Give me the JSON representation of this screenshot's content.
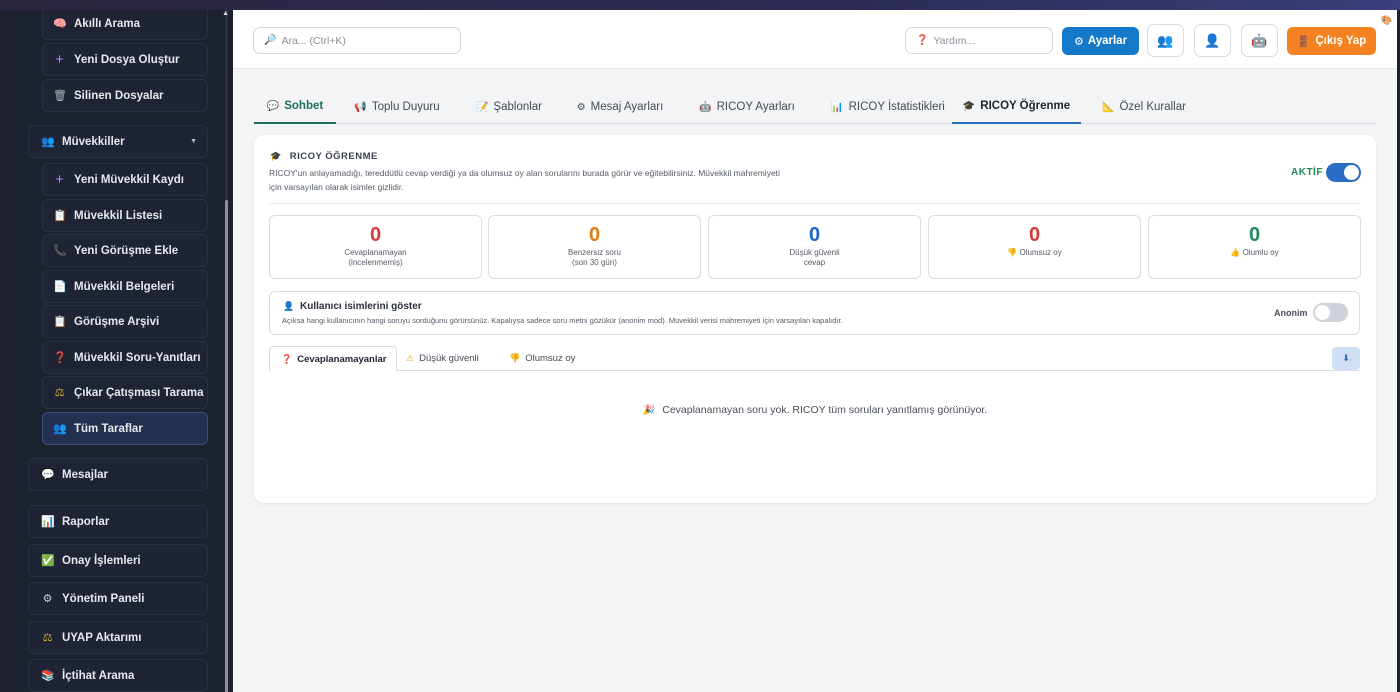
{
  "sidebar": {
    "sub_items_top": [
      {
        "label": "Akıllı Arama",
        "icon": "brain-icon",
        "glyph": "🧠"
      },
      {
        "label": "Yeni Dosya Oluştur",
        "icon": "plus-icon",
        "glyph": "+"
      },
      {
        "label": "Silinen Dosyalar",
        "icon": "trash-icon",
        "glyph": "🗑"
      }
    ],
    "group": {
      "label": "Müvekkiller",
      "icon": "people-icon",
      "glyph": "👥",
      "chevron": "▼"
    },
    "sub_items": [
      {
        "label": "Yeni Müvekkil Kaydı",
        "icon": "plus-icon",
        "glyph": "+"
      },
      {
        "label": "Müvekkil Listesi",
        "icon": "list-icon",
        "glyph": "📋"
      },
      {
        "label": "Yeni Görüşme Ekle",
        "icon": "phone-icon",
        "glyph": "📞"
      },
      {
        "label": "Müvekkil Belgeleri",
        "icon": "document-icon",
        "glyph": "📄"
      },
      {
        "label": "Görüşme Arşivi",
        "icon": "archive-icon",
        "glyph": "📋"
      },
      {
        "label": "Müvekkil Soru-Yanıtları",
        "icon": "question-icon",
        "glyph": "❓"
      },
      {
        "label": "Çıkar Çatışması Tarama",
        "icon": "scale-icon",
        "glyph": "⚖"
      },
      {
        "label": "Tüm Taraflar",
        "icon": "parties-icon",
        "glyph": "👥"
      }
    ],
    "main_items": [
      {
        "label": "Mesajlar",
        "icon": "chat-icon",
        "glyph": "💬"
      },
      {
        "label": "Raporlar",
        "icon": "chart-icon",
        "glyph": "📊"
      },
      {
        "label": "Onay İşlemleri",
        "icon": "check-icon",
        "glyph": "✅"
      },
      {
        "label": "Yönetim Paneli",
        "icon": "gear-icon",
        "glyph": "⚙"
      },
      {
        "label": "UYAP Aktarımı",
        "icon": "scale-icon",
        "glyph": "⚖"
      },
      {
        "label": "İçtihat Arama",
        "icon": "books-icon",
        "glyph": "📚"
      }
    ]
  },
  "header": {
    "search_placeholder": "Ara... (Ctrl+K)",
    "help_placeholder": "Yardım...",
    "settings_label": "Ayarlar",
    "logout_label": "Çıkış Yap"
  },
  "tabs": [
    {
      "label": "Sohbet",
      "glyph": "💬"
    },
    {
      "label": "Toplu Duyuru",
      "glyph": "📢"
    },
    {
      "label": "Şablonlar",
      "glyph": "📝"
    },
    {
      "label": "Mesaj Ayarları",
      "glyph": "⚙"
    },
    {
      "label": "RICOY Ayarları",
      "glyph": "🤖"
    },
    {
      "label": "RICOY İstatistikleri",
      "glyph": "📊"
    },
    {
      "label": "RICOY Öğrenme",
      "glyph": "🎓"
    },
    {
      "label": "Özel Kurallar",
      "glyph": "📐"
    }
  ],
  "learning": {
    "title": "RICOY ÖĞRENME",
    "description": "RICOY'un anlayamadığı, tereddütlü cevap verdiği ya da olumsuz oy alan sorularını burada görür ve eğitebilirsiniz. Müvekkil mahremiyeti için varsayılan olarak isimler gizlidir.",
    "status_label": "AKTİF",
    "active": true,
    "stats": [
      {
        "value": "0",
        "label": "Cevaplanamayan (incelenmemiş)",
        "color": "#d63a3a"
      },
      {
        "value": "0",
        "label": "Benzersiz soru (son 30 gün)",
        "color": "#e07b12"
      },
      {
        "value": "0",
        "label": "Düşük güvenli cevap",
        "color": "#1d63c9"
      },
      {
        "value": "0",
        "label": "Olumsuz oy",
        "color": "#d63a3a"
      },
      {
        "value": "0",
        "label": "Olumlu oy",
        "color": "#1e8a5b"
      }
    ],
    "show_names": {
      "title": "Kullanıcı isimlerini göster",
      "description": "Açıksa hangi kullanıcının hangi soruyu sorduğunu görürsünüz. Kapalıysa sadece soru metni gözükür (anonim mod). Müvekkil verisi mahremiyeti için varsayılan kapalıdır.",
      "toggle_label": "Anonim",
      "enabled": false
    },
    "sub_tabs": [
      {
        "label": "Cevaplanamayanlar",
        "glyph": "❓"
      },
      {
        "label": "Düşük güvenli",
        "glyph": "⚠"
      },
      {
        "label": "Olumsuz oy",
        "glyph": "👎"
      }
    ],
    "empty_message": "Cevaplanamayan soru yok. RICOY tüm soruları yanıtlamış görünüyor."
  }
}
